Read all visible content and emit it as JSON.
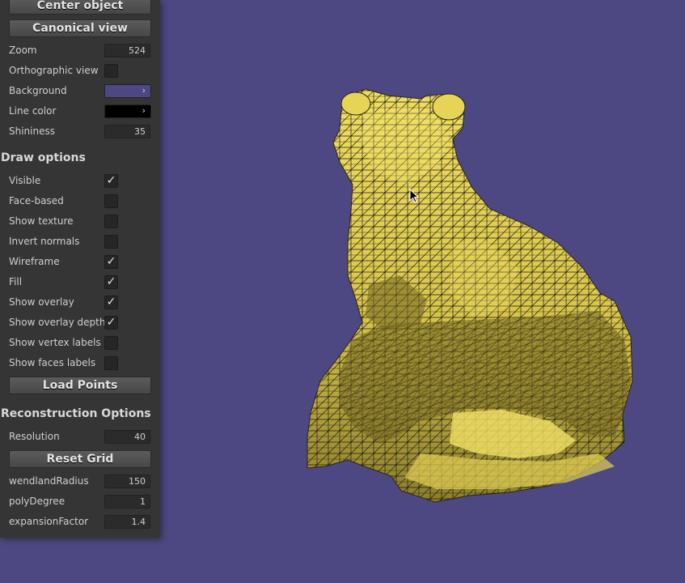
{
  "panel": {
    "buttons": {
      "center_object": "Center object",
      "canonical_view": "Canonical view",
      "load_points": "Load Points",
      "reset_grid": "Reset Grid"
    },
    "viewer": {
      "zoom": {
        "label": "Zoom",
        "value": "524"
      },
      "orthographic": {
        "label": "Orthographic view",
        "checked": false
      },
      "background": {
        "label": "Background",
        "color": "#4e4882",
        "arrow": "›"
      },
      "line_color": {
        "label": "Line color",
        "color": "#000000",
        "arrow": "›"
      },
      "shininess": {
        "label": "Shininess",
        "value": "35"
      }
    },
    "draw_options": {
      "title": "Draw options",
      "items": [
        {
          "label": "Visible",
          "checked": true
        },
        {
          "label": "Face-based",
          "checked": false
        },
        {
          "label": "Show texture",
          "checked": false
        },
        {
          "label": "Invert normals",
          "checked": false
        },
        {
          "label": "Wireframe",
          "checked": true
        },
        {
          "label": "Fill",
          "checked": true
        },
        {
          "label": "Show overlay",
          "checked": true
        },
        {
          "label": "Show overlay depth",
          "checked": true
        },
        {
          "label": "Show vertex labels",
          "checked": false
        },
        {
          "label": "Show faces labels",
          "checked": false
        }
      ]
    },
    "reconstruction": {
      "title": "Reconstruction Options",
      "resolution": {
        "label": "Resolution",
        "value": "40"
      },
      "wendland_radius": {
        "label": "wendlandRadius",
        "value": "150"
      },
      "poly_degree": {
        "label": "polyDegree",
        "value": "1"
      },
      "expansion_factor": {
        "label": "expansionFactor",
        "value": "1.4"
      }
    }
  },
  "check_glyph": "✓",
  "colors": {
    "viewport_background": "#4e4882",
    "mesh_fill": "#e9d85a",
    "mesh_shadow": "#8c7d2c",
    "mesh_lines": "#1a1a10",
    "panel_background": "#353535"
  },
  "icons": {
    "cursor": "arrow-pointer-icon"
  }
}
